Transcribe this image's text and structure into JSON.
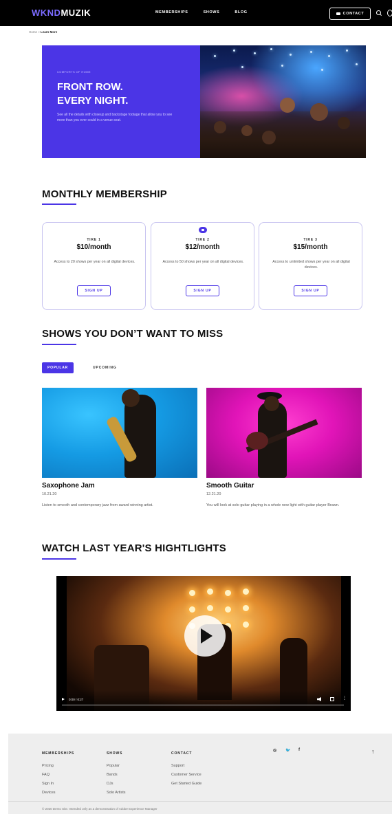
{
  "nav": {
    "logo_a": "WKND",
    "logo_b": "MUZIK",
    "links": [
      "MEMBERSHIPS",
      "SHOWS",
      "BLOG"
    ],
    "contact": "CONTACT"
  },
  "breadcrumb": {
    "home": "Home",
    "sep": " » ",
    "current": "Learn More"
  },
  "hero": {
    "kicker": "COMFORTS OF HOME",
    "title_line1": "FRONT ROW.",
    "title_line2": "EVERY NIGHT.",
    "text": "See all the details with closeup and backstage footage that allow you to see more than you ever could in a venue seat."
  },
  "membership": {
    "title": "MONTHLY MEMBERSHIP",
    "tiers": [
      {
        "tier": "TIRE 1",
        "price": "$10/month",
        "desc": "Access to 20 shows per year on all digital devices.",
        "button": "SIGN UP"
      },
      {
        "tier": "TIRE 2",
        "price": "$12/month",
        "desc": "Access to 50 shows per year on all digital devices.",
        "button": "SIGN UP"
      },
      {
        "tier": "TIRE 3",
        "price": "$15/month",
        "desc": "Access to unlimited shows per year on all digital devices.",
        "button": "SIGN UP"
      }
    ]
  },
  "shows": {
    "title": "SHOWS YOU DON’T WANT TO MISS",
    "tabs": [
      "POPULAR",
      "UPCOMING"
    ],
    "items": [
      {
        "title": "Saxophone Jam",
        "date": "10.21.20",
        "desc": "Listen to smooth and contemporary jazz from award winning artist."
      },
      {
        "title": "Smooth Guitar",
        "date": "12.21.20",
        "desc": "You will look at solo guitar playing in a whole new light with guitar player Brawn."
      }
    ]
  },
  "highlights": {
    "title": "WATCH LAST YEAR'S HIGHTLIGHTS",
    "time": "0:00 / 0:27",
    "more": "⋮"
  },
  "footer": {
    "columns": [
      {
        "head": "MEMBERSHIPS",
        "links": [
          "Pricing",
          "FAQ",
          "Sign In",
          "Devices"
        ]
      },
      {
        "head": "SHOWS",
        "links": [
          "Popular",
          "Bands",
          "DJs",
          "Solo Artists"
        ]
      },
      {
        "head": "CONTACT",
        "links": [
          "Support",
          "Customer Service",
          "Get Started Guide"
        ]
      }
    ],
    "social": [
      "◎",
      "🐦",
      "f"
    ],
    "up": "↑",
    "copyright": "© 2020 Demo Site. Intended only as a demonstration of Adobe Experience Manager"
  }
}
